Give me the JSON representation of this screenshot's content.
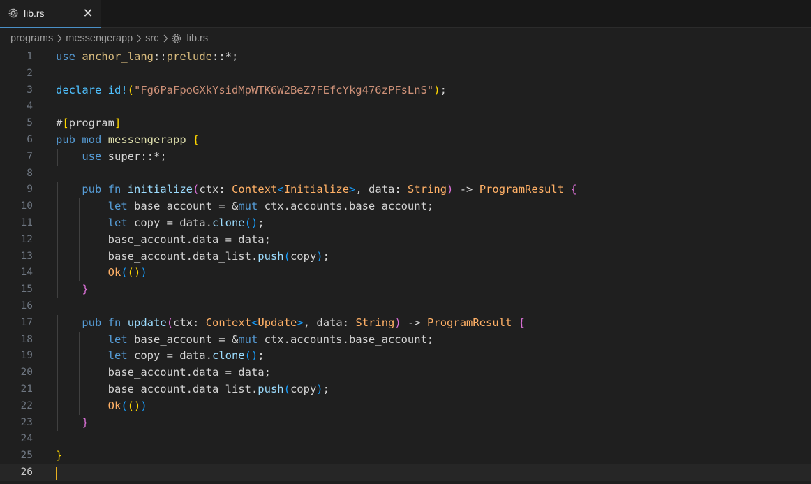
{
  "tab": {
    "label": "lib.rs",
    "close": "✕",
    "icon": "rust-gear-icon"
  },
  "breadcrumb": {
    "items": [
      "programs",
      "messengerapp",
      "src",
      "lib.rs"
    ],
    "sep": "chevron-right-icon"
  },
  "code": {
    "lines": [
      [
        [
          "kw2",
          "use"
        ],
        [
          "plain",
          " "
        ],
        [
          "ns",
          "anchor_lang"
        ],
        [
          "punc",
          "::"
        ],
        [
          "ns",
          "prelude"
        ],
        [
          "punc",
          "::*;"
        ]
      ],
      [],
      [
        [
          "mac",
          "declare_id!"
        ],
        [
          "br1",
          "("
        ],
        [
          "str",
          "\"Fg6PaFpoGXkYsidMpWTK6W2BeZ7FEfcYkg476zPFsLnS\""
        ],
        [
          "br1",
          ")"
        ],
        [
          "punc",
          ";"
        ]
      ],
      [],
      [
        [
          "plain",
          "#"
        ],
        [
          "br1",
          "["
        ],
        [
          "plain",
          "program"
        ],
        [
          "br1",
          "]"
        ]
      ],
      [
        [
          "kw2",
          "pub"
        ],
        [
          "plain",
          " "
        ],
        [
          "kw2",
          "mod"
        ],
        [
          "plain",
          " "
        ],
        [
          "fn",
          "messengerapp"
        ],
        [
          "plain",
          " "
        ],
        [
          "br1",
          "{"
        ]
      ],
      [
        [
          "plain",
          "    "
        ],
        [
          "kw2",
          "use"
        ],
        [
          "plain",
          " super::*;"
        ]
      ],
      [],
      [
        [
          "plain",
          "    "
        ],
        [
          "kw2",
          "pub"
        ],
        [
          "plain",
          " "
        ],
        [
          "kw2",
          "fn"
        ],
        [
          "plain",
          " "
        ],
        [
          "lit",
          "initialize"
        ],
        [
          "br2",
          "("
        ],
        [
          "plain",
          "ctx: "
        ],
        [
          "type",
          "Context"
        ],
        [
          "br3",
          "<"
        ],
        [
          "type",
          "Initialize"
        ],
        [
          "br3",
          ">"
        ],
        [
          "plain",
          ", data: "
        ],
        [
          "type",
          "String"
        ],
        [
          "br2",
          ")"
        ],
        [
          "plain",
          " -> "
        ],
        [
          "type",
          "ProgramResult"
        ],
        [
          "plain",
          " "
        ],
        [
          "br2",
          "{"
        ]
      ],
      [
        [
          "plain",
          "        "
        ],
        [
          "kw2",
          "let"
        ],
        [
          "plain",
          " base_account = &"
        ],
        [
          "kw2",
          "mut"
        ],
        [
          "plain",
          " ctx.accounts.base_account;"
        ]
      ],
      [
        [
          "plain",
          "        "
        ],
        [
          "kw2",
          "let"
        ],
        [
          "plain",
          " copy = data."
        ],
        [
          "lit",
          "clone"
        ],
        [
          "br3",
          "()"
        ],
        [
          "plain",
          ";"
        ]
      ],
      [
        [
          "plain",
          "        base_account.data = data;"
        ]
      ],
      [
        [
          "plain",
          "        base_account.data_list."
        ],
        [
          "lit",
          "push"
        ],
        [
          "br3",
          "("
        ],
        [
          "plain",
          "copy"
        ],
        [
          "br3",
          ")"
        ],
        [
          "plain",
          ";"
        ]
      ],
      [
        [
          "plain",
          "        "
        ],
        [
          "ok",
          "Ok"
        ],
        [
          "br3",
          "("
        ],
        [
          "br1",
          "()"
        ],
        [
          "br3",
          ")"
        ]
      ],
      [
        [
          "plain",
          "    "
        ],
        [
          "br2",
          "}"
        ]
      ],
      [],
      [
        [
          "plain",
          "    "
        ],
        [
          "kw2",
          "pub"
        ],
        [
          "plain",
          " "
        ],
        [
          "kw2",
          "fn"
        ],
        [
          "plain",
          " "
        ],
        [
          "lit",
          "update"
        ],
        [
          "br2",
          "("
        ],
        [
          "plain",
          "ctx: "
        ],
        [
          "type",
          "Context"
        ],
        [
          "br3",
          "<"
        ],
        [
          "type",
          "Update"
        ],
        [
          "br3",
          ">"
        ],
        [
          "plain",
          ", data: "
        ],
        [
          "type",
          "String"
        ],
        [
          "br2",
          ")"
        ],
        [
          "plain",
          " -> "
        ],
        [
          "type",
          "ProgramResult"
        ],
        [
          "plain",
          " "
        ],
        [
          "br2",
          "{"
        ]
      ],
      [
        [
          "plain",
          "        "
        ],
        [
          "kw2",
          "let"
        ],
        [
          "plain",
          " base_account = &"
        ],
        [
          "kw2",
          "mut"
        ],
        [
          "plain",
          " ctx.accounts.base_account;"
        ]
      ],
      [
        [
          "plain",
          "        "
        ],
        [
          "kw2",
          "let"
        ],
        [
          "plain",
          " copy = data."
        ],
        [
          "lit",
          "clone"
        ],
        [
          "br3",
          "()"
        ],
        [
          "plain",
          ";"
        ]
      ],
      [
        [
          "plain",
          "        base_account.data = data;"
        ]
      ],
      [
        [
          "plain",
          "        base_account.data_list."
        ],
        [
          "lit",
          "push"
        ],
        [
          "br3",
          "("
        ],
        [
          "plain",
          "copy"
        ],
        [
          "br3",
          ")"
        ],
        [
          "plain",
          ";"
        ]
      ],
      [
        [
          "plain",
          "        "
        ],
        [
          "ok",
          "Ok"
        ],
        [
          "br3",
          "("
        ],
        [
          "br1",
          "()"
        ],
        [
          "br3",
          ")"
        ]
      ],
      [
        [
          "plain",
          "    "
        ],
        [
          "br2",
          "}"
        ]
      ],
      [],
      [
        [
          "br1",
          "}"
        ]
      ],
      []
    ],
    "current_line": 26
  },
  "colors": {
    "background": "#1f1f1f",
    "tab_active_border": "#4a90c8",
    "cursor": "#e8b020"
  }
}
